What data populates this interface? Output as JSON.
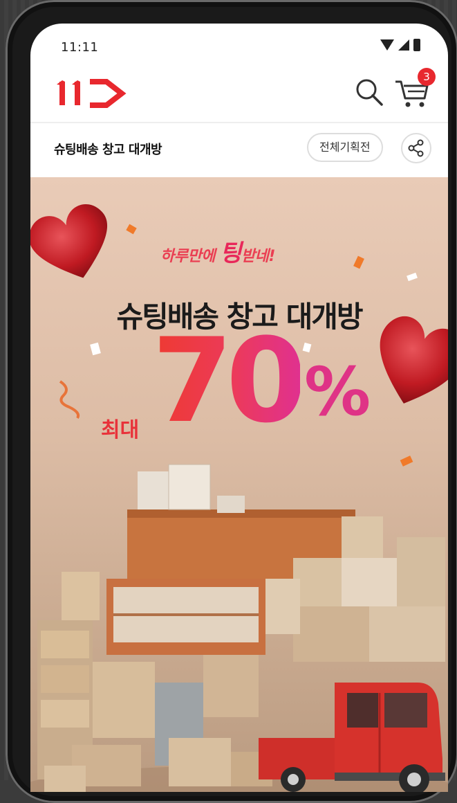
{
  "status": {
    "time": "11:11"
  },
  "appbar": {
    "logo_alt": "11번가",
    "cart_count": "3"
  },
  "subheader": {
    "title": "슈팅배송 창고 대개방",
    "all_events_label": "전체기획전"
  },
  "banner": {
    "tagline_prefix": "하루만에 ",
    "tagline_emph": "팅",
    "tagline_suffix": "받네!",
    "headline": "슈팅배송 창고 대개방",
    "upto": "최대",
    "discount_number": "70",
    "discount_symbol": "%"
  },
  "colors": {
    "brand": "#e8282e",
    "banner_bg": "#e2c4ae"
  },
  "icons": [
    "search-icon",
    "cart-icon",
    "share-icon",
    "wifi-icon",
    "signal-icon",
    "battery-icon"
  ]
}
